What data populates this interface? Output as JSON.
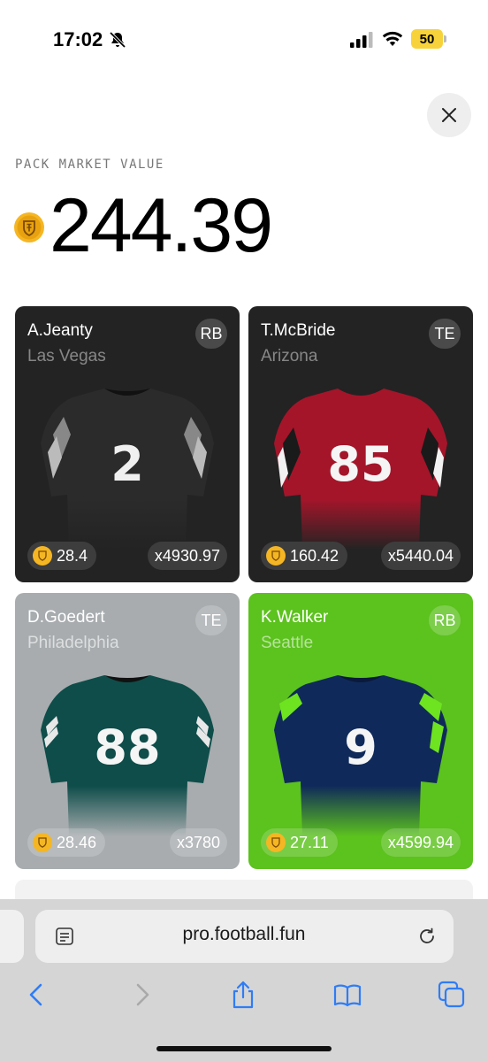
{
  "status_bar": {
    "time": "17:02",
    "battery": "50",
    "icons": [
      "bell-slash-icon",
      "signal-icon",
      "wifi-icon",
      "battery-icon"
    ]
  },
  "header": {
    "label": "PACK MARKET VALUE",
    "value": "244.39",
    "coin_icon": "shield-coin-icon"
  },
  "cards": [
    {
      "name": "A.Jeanty",
      "team": "Las Vegas",
      "position": "RB",
      "number": "2",
      "price": "28.4",
      "multiplier": "x4930.97",
      "jersey_color": "#2a2a2a",
      "card_color": "#232323"
    },
    {
      "name": "T.McBride",
      "team": "Arizona",
      "position": "TE",
      "number": "85",
      "price": "160.42",
      "multiplier": "x5440.04",
      "jersey_color": "#a4152a",
      "card_color": "#232323"
    },
    {
      "name": "D.Goedert",
      "team": "Philadelphia",
      "position": "TE",
      "number": "88",
      "price": "28.46",
      "multiplier": "x3780",
      "jersey_color": "#0e4d4a",
      "card_color": "#a8acaf"
    },
    {
      "name": "K.Walker",
      "team": "Seattle",
      "position": "RB",
      "number": "9",
      "price": "27.11",
      "multiplier": "x4599.94",
      "jersey_color": "#0f2a5a",
      "card_color": "#5cc21e"
    }
  ],
  "browser": {
    "url": "pro.football.fun",
    "icons": [
      "reader-icon",
      "reload-icon",
      "back-icon",
      "forward-icon",
      "share-icon",
      "bookmarks-icon",
      "tabs-icon"
    ]
  },
  "colors": {
    "coin": "#f5b623",
    "ios_blue": "#2f7cf6"
  }
}
